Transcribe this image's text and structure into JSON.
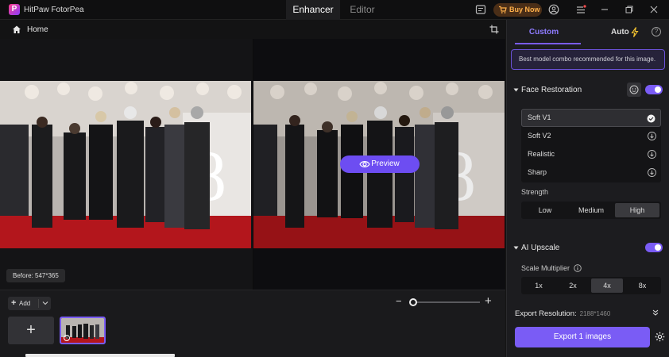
{
  "app": {
    "title": "HitPaw FotorPea",
    "tabs": [
      "Enhancer",
      "Editor"
    ],
    "active_tab": "Enhancer",
    "buy_label": "Buy Now"
  },
  "breadcrumb": {
    "home_label": "Home"
  },
  "canvas": {
    "preview_label": "Preview",
    "before_label": "Before: 547*365"
  },
  "bottom": {
    "add_label": "Add"
  },
  "panel": {
    "tabs": {
      "custom": "Custom",
      "auto": "Auto"
    },
    "tip": "Best model combo recommended for this image.",
    "face_restoration": {
      "title": "Face Restoration",
      "enabled": true,
      "models": [
        {
          "label": "Soft V1",
          "state": "selected"
        },
        {
          "label": "Soft V2",
          "state": "download"
        },
        {
          "label": "Realistic",
          "state": "download"
        },
        {
          "label": "Sharp",
          "state": "download"
        }
      ],
      "strength_label": "Strength",
      "strength_options": [
        "Low",
        "Medium",
        "High"
      ],
      "strength_selected": "High"
    },
    "ai_upscale": {
      "title": "AI Upscale",
      "enabled": true,
      "scale_label": "Scale Multiplier",
      "scale_options": [
        "1x",
        "2x",
        "4x",
        "8x"
      ],
      "scale_selected": "4x"
    },
    "export_resolution_label": "Export Resolution:",
    "export_resolution_value": "2188*1460",
    "export_button": "Export 1 images"
  },
  "colors": {
    "accent": "#7a5cf5",
    "buy_bg": "#4a2e17",
    "buy_text": "#ffb04a",
    "carpet": "#b3161c"
  },
  "icons": [
    "home-icon",
    "crop-icon",
    "eye-icon",
    "cart-icon",
    "bolt-icon",
    "help-icon",
    "face-icon",
    "check-icon",
    "download-icon",
    "info-icon",
    "gear-icon",
    "chevron-down-icon",
    "double-chevron-down-icon"
  ]
}
